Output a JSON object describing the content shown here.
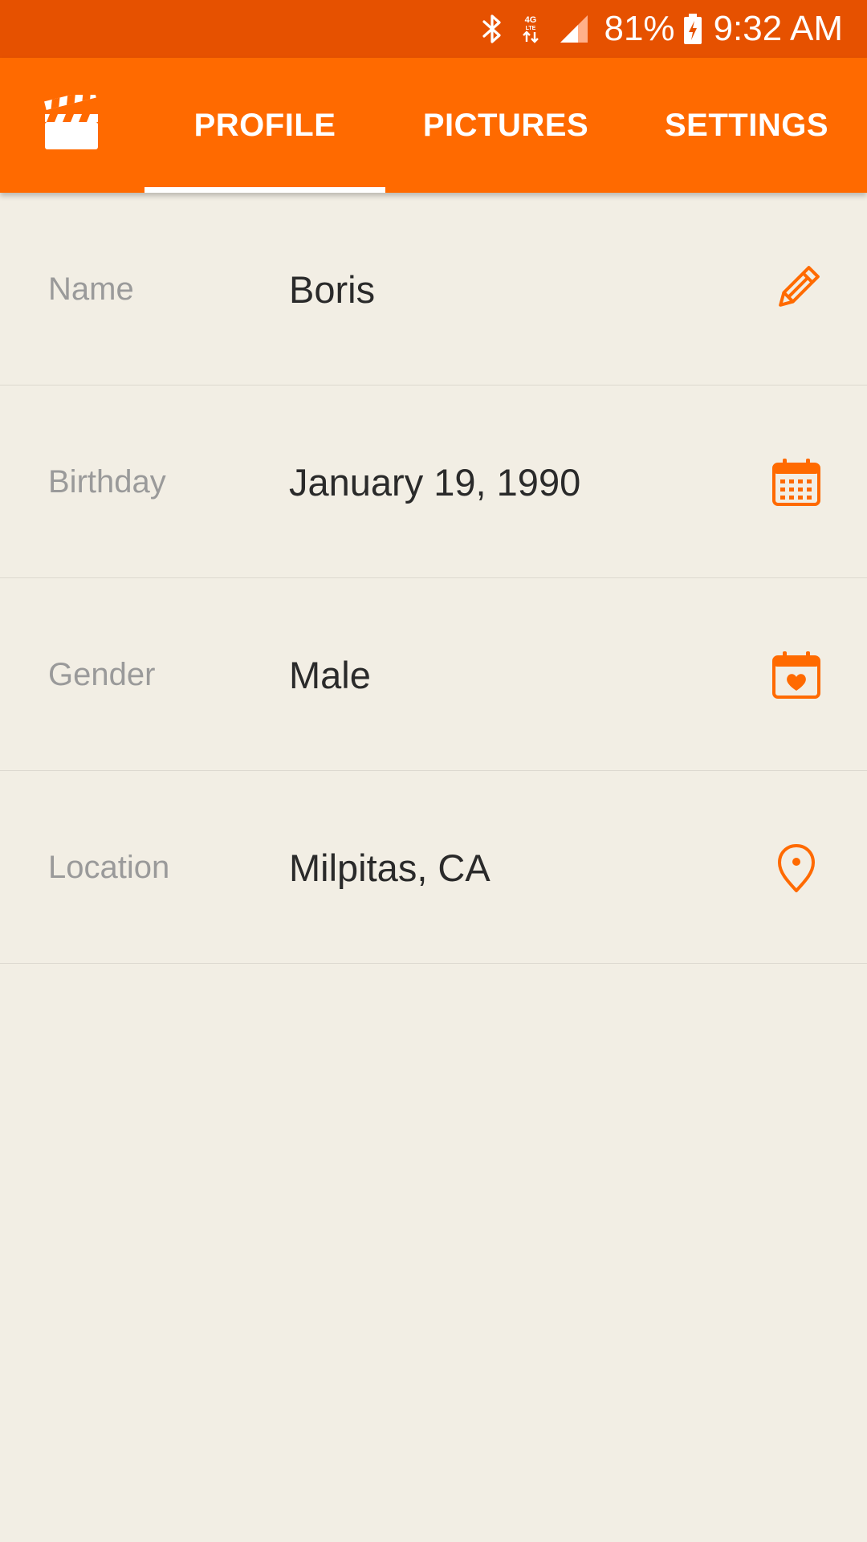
{
  "status_bar": {
    "network": "4G LTE",
    "battery": "81%",
    "time": "9:32 AM",
    "icons": [
      "bluetooth-icon",
      "network-data-icon",
      "signal-icon",
      "battery-charging-icon"
    ]
  },
  "app_bar": {
    "logo_icon": "clapperboard-icon",
    "tabs": [
      {
        "label": "PROFILE",
        "active": true
      },
      {
        "label": "PICTURES",
        "active": false
      },
      {
        "label": "SETTINGS",
        "active": false
      }
    ]
  },
  "profile": {
    "fields": [
      {
        "label": "Name",
        "value": "Boris",
        "icon": "pencil-icon"
      },
      {
        "label": "Birthday",
        "value": "January 19, 1990",
        "icon": "calendar-icon"
      },
      {
        "label": "Gender",
        "value": "Male",
        "icon": "calendar-heart-icon"
      },
      {
        "label": "Location",
        "value": "Milpitas, CA",
        "icon": "location-pin-icon"
      }
    ]
  },
  "colors": {
    "status_bar": "#e65100",
    "app_bar": "#ff6a00",
    "accent": "#ff6a00",
    "background": "#f2eee4",
    "label_text": "#9a9a9a",
    "value_text": "#2a2a2a"
  }
}
